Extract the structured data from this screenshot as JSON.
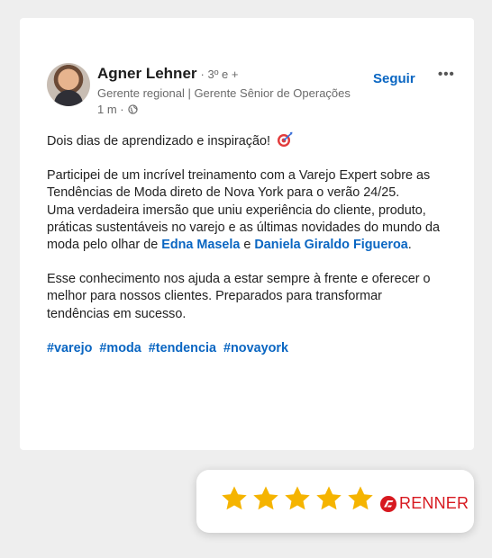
{
  "post": {
    "author": "Agner Lehner",
    "degree": "· 3º e +",
    "headline": "Gerente regional | Gerente Sênior de Operações",
    "time": "1 m ·",
    "follow_label": "Seguir",
    "more_label": "•••",
    "line1": "Dois dias de aprendizado e inspiração!",
    "para2": "Participei de um incrível treinamento com a Varejo Expert sobre as Tendências de Moda direto de Nova York para o verão 24/25.",
    "para3_before": "Uma verdadeira imersão que uniu experiência do cliente, produto, práticas sustentáveis no varejo e as últimas novidades do mundo da moda pelo olhar de ",
    "mention1": "Edna Masela",
    "para3_and": " e ",
    "mention2": "Daniela Giraldo Figueroa",
    "para3_end": ".",
    "para4": "Esse conhecimento nos ajuda a estar sempre à frente e oferecer o melhor para nossos clientes. Preparados para transformar tendências em sucesso.",
    "hashtags": [
      "#varejo",
      "#moda",
      "#tendencia",
      "#novayork"
    ]
  },
  "rating": {
    "stars": 5,
    "max": 5,
    "star_color": "#f5b400",
    "brand": "RENNER",
    "brand_color": "#d71920"
  },
  "colors": {
    "link": "#0a66c2",
    "muted": "#6a6a6a"
  }
}
